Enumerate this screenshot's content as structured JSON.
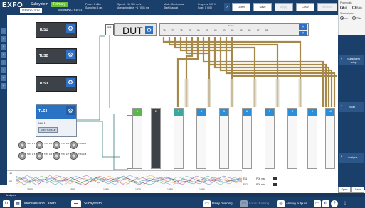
{
  "app": {
    "logo": "EXFO",
    "tabs": [
      {
        "label": "Subsystem"
      },
      {
        "label": "Primary"
      }
    ],
    "subtabs": [
      {
        "label": "Primary CTP10"
      },
      {
        "label": "Secondary CTP10 #1"
      }
    ]
  },
  "header_params": {
    "col1": "Power: 5 dBm\nSampling: 1 pm",
    "col2": "Speed: ~1 / 100 nm/s\nAveraging time: ~1 / 0.01 ms",
    "col3": "Mode: Continuous\nStart Manual",
    "col4": "Progress: 100 %\nScan: 1 (0/1)"
  },
  "toolbar": {
    "open": "Open",
    "save": "Save",
    "apply": "Apply",
    "clear": "Clear",
    "remove": "Remove"
  },
  "power_panel": {
    "title1": "Power units",
    "opt1": "dB",
    "opt2": "Ratio",
    "title2": "Spectral proc.",
    "opt3": "nm",
    "opt4": "THz"
  },
  "lasers": [
    {
      "label": "TLS1"
    },
    {
      "label": "TLS2"
    },
    {
      "label": "TLS3"
    },
    {
      "label": "TLS4"
    }
  ],
  "tls4": {
    "sub1": "Laser 1",
    "sub2": "EXFO T100S-HP"
  },
  "ports": [
    {
      "label": "TRIG\nIn 1"
    },
    {
      "label": "TRIG\nIn 2"
    },
    {
      "label": "TRIG\nIn 3"
    },
    {
      "label": "TRIG\nIn 4"
    },
    {
      "label": "TRIG\nIn 5"
    },
    {
      "label": "TRIG\nIn 6"
    },
    {
      "label": "TRIG\nIn 7"
    },
    {
      "label": "TRIG\nIn 8"
    }
  ],
  "dut": {
    "title": "DUT",
    "input_label": "Input",
    "output_label": "Output",
    "outputs": [
      "76",
      "77",
      "78",
      "79",
      "80",
      "81",
      "82",
      "83",
      "84",
      "85",
      "86",
      "87",
      "88"
    ]
  },
  "columns": [
    {
      "title": "1",
      "color": "green"
    },
    {
      "title": "2",
      "color": "dark"
    },
    {
      "title": "3",
      "color": "teal"
    },
    {
      "title": "4",
      "color": "blue"
    },
    {
      "title": "5",
      "color": "blue"
    },
    {
      "title": "6",
      "color": "blue"
    },
    {
      "title": "7",
      "color": "blue"
    },
    {
      "title": "8",
      "color": "blue"
    },
    {
      "title": "9",
      "color": "blue"
    },
    {
      "title": "10",
      "color": "blue"
    }
  ],
  "spectrum": {
    "x_ticks": [
      "1500",
      "1540",
      "1560",
      "1570",
      "1580",
      "1590"
    ],
    "y_ticks": [
      "-40",
      "-60"
    ]
  },
  "bottom_table": [
    {
      "id": "E11",
      "name": "PDL max"
    },
    {
      "id": "E12",
      "name": "PDL min"
    }
  ],
  "right_panel": {
    "subsystem_setup": "Subsystem setup",
    "scan": "Scan",
    "analysis": "Analysis",
    "open": "Open",
    "save": "Save"
  },
  "bottom_bar": {
    "analyses": "Analyses",
    "modules_lasers": "Modules and Lasers",
    "subsystem": "Subsystem",
    "daisy": "Daisy chaining",
    "local": "Local chaining",
    "analog": "Analog outputs",
    "help": "?"
  },
  "colors": {
    "primary": "#1b3f6b",
    "accent": "#2f70c4",
    "green": "#6cbf3a",
    "fiber": "#a5894b"
  }
}
